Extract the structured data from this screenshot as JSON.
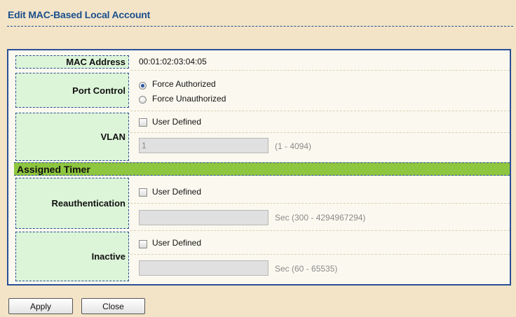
{
  "page": {
    "title": "Edit MAC-Based Local Account"
  },
  "form": {
    "mac_address": {
      "label": "MAC Address",
      "value": "00:01:02:03:04:05"
    },
    "port_control": {
      "label": "Port Control",
      "options": [
        {
          "label": "Force Authorized",
          "selected": true
        },
        {
          "label": "Force Unauthorized",
          "selected": false
        }
      ]
    },
    "vlan": {
      "label": "VLAN",
      "checkbox_label": "User Defined",
      "checked": false,
      "value": "1",
      "range_hint": "(1 - 4094)"
    },
    "assigned_timer": {
      "section_title": "Assigned Timer"
    },
    "reauthentication": {
      "label": "Reauthentication",
      "checkbox_label": "User Defined",
      "checked": false,
      "value": "",
      "range_hint": "Sec (300 - 4294967294)"
    },
    "inactive": {
      "label": "Inactive",
      "checkbox_label": "User Defined",
      "checked": false,
      "value": "",
      "range_hint": "Sec (60 - 65535)"
    }
  },
  "buttons": {
    "apply": "Apply",
    "close": "Close"
  },
  "colors": {
    "page_background": "#f3e4c8",
    "title_blue": "#1a4f8c",
    "label_cell_green": "#dcf4d8",
    "section_band_green": "#8fc63f",
    "panel_border": "#2a4e96"
  }
}
